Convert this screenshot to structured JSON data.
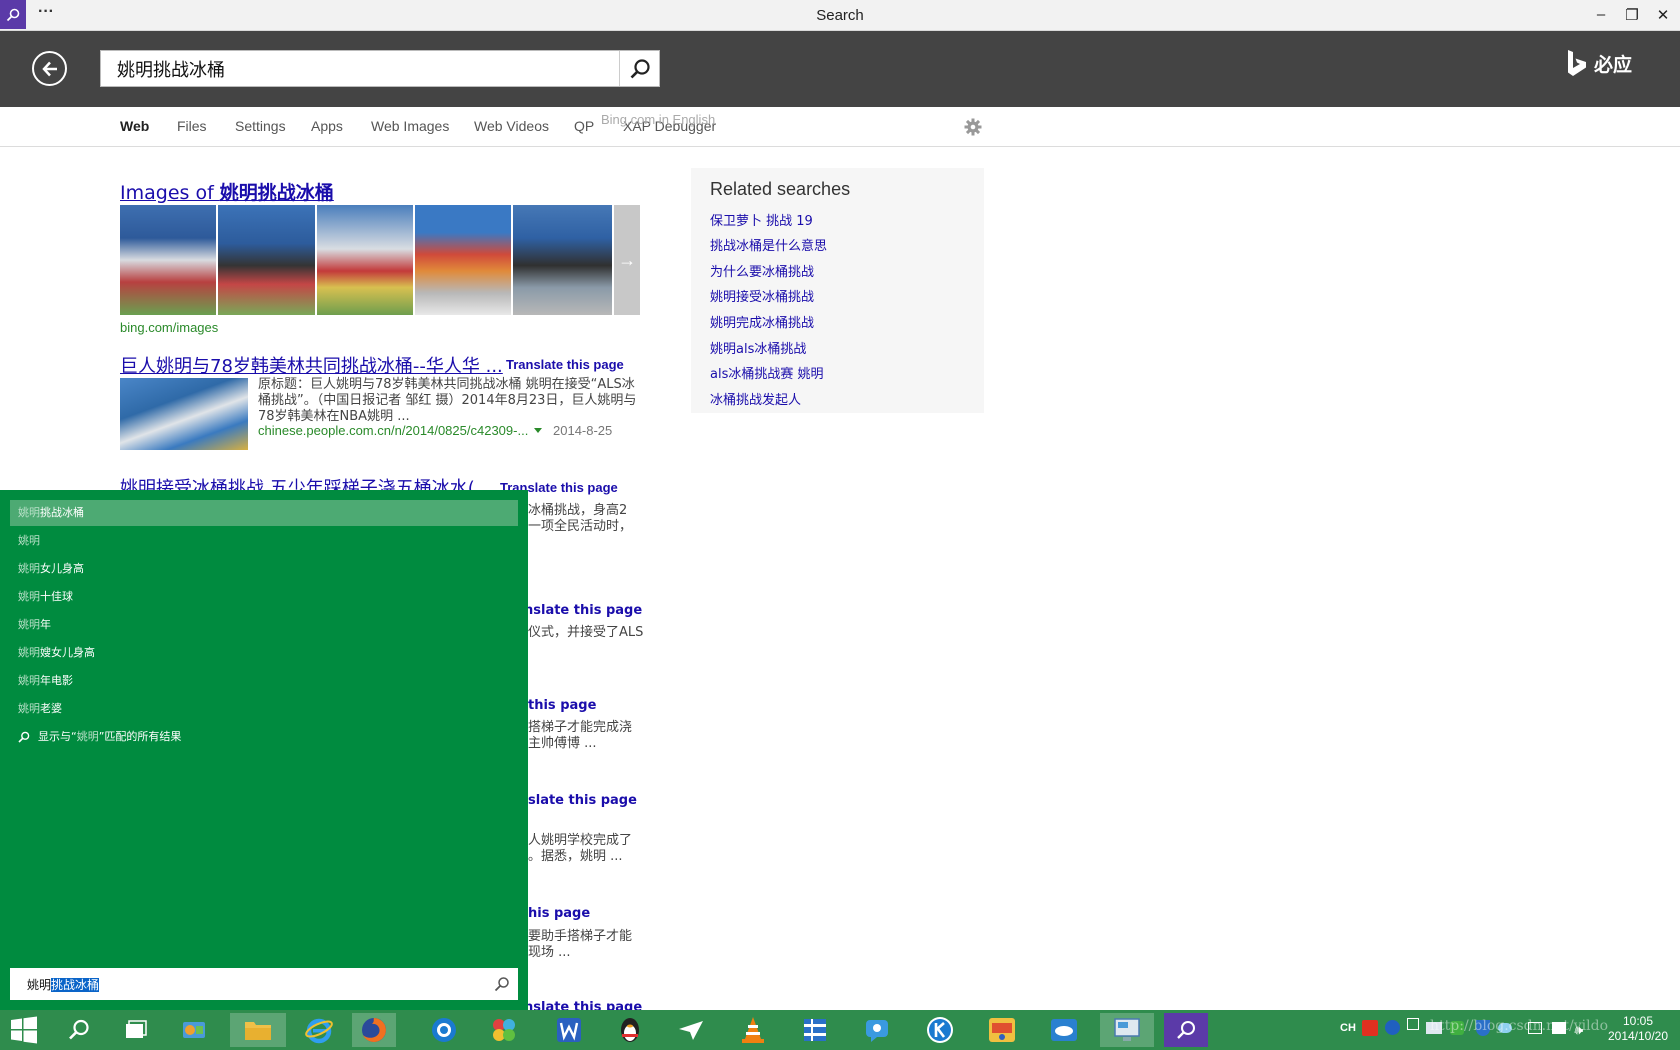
{
  "window": {
    "title": "Search",
    "menu": "···",
    "minimize": "–",
    "restore": "❐",
    "close": "✕"
  },
  "header": {
    "query": "姚明挑战冰桶",
    "brand": "必应"
  },
  "nav": {
    "tabs": [
      "Web",
      "Files",
      "Settings",
      "Apps",
      "Web Images",
      "Web Videos",
      "QP",
      "XAP Debugger"
    ],
    "overlay": "Bing.com in English"
  },
  "images_block": {
    "title_prefix": "Images of ",
    "title_query": "姚明挑战冰桶",
    "source": "bing.com/images"
  },
  "results": [
    {
      "title": "巨人姚明与78岁韩美林共同挑战冰桶--华人华 ...",
      "translate": "Translate this page",
      "snippet_line1": "原标题：巨人姚明与78岁韩美林共同挑战冰桶 姚明在接受“ALS冰",
      "snippet_line2": "桶挑战”。（中国日报记者 邹红 摄）2014年8月23日，巨人姚明与",
      "snippet_line3": "78岁韩美林在NBA姚明 ...",
      "url": "chinese.people.com.cn/n/2014/0825/c42309-...",
      "date": "2014-8-25"
    },
    {
      "title": "姚明接受冰桶挑战 五少年踩梯子浇五桶冰水(...",
      "translate": "Translate this page"
    }
  ],
  "fragments": [
    "冰桶挑战，身高2",
    "一项全民活动时，",
    "nslate this page",
    "仪式，并接受了ALS",
    "this page",
    "搭梯子才能完成浇",
    "主帅傅博 ...",
    "slate this page",
    "人姚明学校完成了",
    "。据悉，姚明 ...",
    "his page",
    "要助手搭梯子才能",
    "现场 ...",
    "nslate this page"
  ],
  "related": {
    "title": "Related searches",
    "items": [
      "保卫萝卜 挑战 19",
      "挑战冰桶是什么意思",
      "为什么要冰桶挑战",
      "姚明接受冰桶挑战",
      "姚明完成冰桶挑战",
      "姚明als冰桶挑战",
      "als冰桶挑战赛 姚明",
      "冰桶挑战发起人"
    ]
  },
  "search_pane": {
    "suggestions": [
      {
        "prefix": "姚明",
        "rest": "挑战冰桶"
      },
      {
        "prefix": "姚明",
        "rest": ""
      },
      {
        "prefix": "姚明",
        "rest": "女儿身高"
      },
      {
        "prefix": "姚明",
        "rest": "十佳球"
      },
      {
        "prefix": "姚明",
        "rest": "年"
      },
      {
        "prefix": "姚明",
        "rest": "嫂女儿身高"
      },
      {
        "prefix": "姚明",
        "rest": "年电影"
      },
      {
        "prefix": "姚明",
        "rest": "老婆"
      }
    ],
    "show_all_prefix": "显示与“",
    "show_all_term": "姚明",
    "show_all_suffix": "”匹配的所有结果",
    "input_typed": "姚明",
    "input_selected": "挑战冰桶"
  },
  "taskbar": {
    "clock_time": "10:05",
    "clock_date": "2014/10/20",
    "ime": "CH",
    "watermark": "http://blog.csdn.net/yildo"
  },
  "colors": {
    "header": "#444444",
    "pane": "#008b3f",
    "taskbar": "#2f8c4d",
    "link": "#1a0dab",
    "url": "#2a8a2a"
  }
}
